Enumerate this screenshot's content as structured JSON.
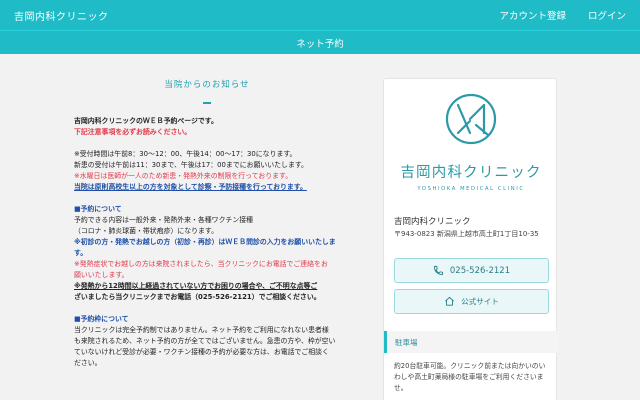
{
  "header": {
    "brand": "吉岡内科クリニック",
    "nav": [
      "アカウント登録",
      "ログイン"
    ],
    "subnav": "ネット予約"
  },
  "notice": {
    "title": "当院からのお知らせ",
    "lines": [
      "吉岡内科クリニックのＷＥＢ予約ページです。",
      "下記注意事項を必ずお読みください。",
      "",
      "※受付時間は午前8：30〜12：00、午後14：00〜17：30になります。",
      "新患の受付は午前は11：30まで、午後は17：00までにお願いいたします。",
      "※水曜日は医師が一人のため新患・発熱外来の制限を行っております。",
      "当院は原則高校生以上の方を対象として診察・予防接種を行っております。",
      "",
      "■予約について",
      "予約できる内容は一般外来・発熱外来・各種ワクチン接種",
      "（コロナ・肺炎球菌・帯状疱疹）になります。",
      "※初診の方・発熱でお越しの方（初診・再診）はＷＥＢ問診の入力をお願いいたしま",
      "す。",
      "※発熱症状でお越しの方は来院されましたら、当クリニックにお電話でご連絡をお",
      "願いいたします。",
      "※発熱から12時間以上経過されていない方でお困りの場合や、ご不明な点等ご",
      "ざいましたら当クリニックまでお電話（025-526-2121）でご相談ください。",
      "",
      "■予約枠について",
      "当クリニックは完全予約制ではありません。ネット予約をご利用になれない患者様",
      "も来院されるため、ネット予約の方が全てではございません。急患の方や、枠が空い",
      "ていないけれど受診が必要・ワクチン接種の予約が必要な方は、お電話でご相談く",
      "ださい。"
    ]
  },
  "clinic": {
    "logo_text": "吉岡内科クリニック",
    "logo_sub": "YOSHIOKA MEDICAL CLINIC",
    "name": "吉岡内科クリニック",
    "address": "〒943-0823 新潟県上越市高土町1丁目10-35",
    "phone": "025-526-2121",
    "website_label": "公式サイト",
    "parking_title": "駐車場",
    "parking_text": "約20台駐車可能。クリニック前または向かいのいわしや高土町薬局様の駐車場をご利用くださいませ。"
  },
  "colors": {
    "accent": "#1fbcc8",
    "red": "#e03a4a",
    "blue": "#1f4fa8"
  },
  "icons": [
    "phone-icon",
    "home-icon",
    "clinic-logo"
  ]
}
